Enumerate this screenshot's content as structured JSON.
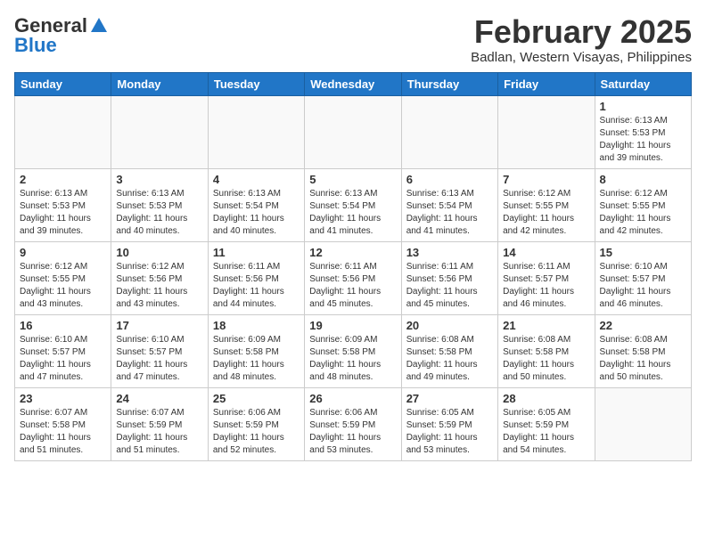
{
  "header": {
    "logo_general": "General",
    "logo_blue": "Blue",
    "month_title": "February 2025",
    "location": "Badlan, Western Visayas, Philippines"
  },
  "weekdays": [
    "Sunday",
    "Monday",
    "Tuesday",
    "Wednesday",
    "Thursday",
    "Friday",
    "Saturday"
  ],
  "weeks": [
    [
      {
        "day": "",
        "info": ""
      },
      {
        "day": "",
        "info": ""
      },
      {
        "day": "",
        "info": ""
      },
      {
        "day": "",
        "info": ""
      },
      {
        "day": "",
        "info": ""
      },
      {
        "day": "",
        "info": ""
      },
      {
        "day": "1",
        "info": "Sunrise: 6:13 AM\nSunset: 5:53 PM\nDaylight: 11 hours and 39 minutes."
      }
    ],
    [
      {
        "day": "2",
        "info": "Sunrise: 6:13 AM\nSunset: 5:53 PM\nDaylight: 11 hours and 39 minutes."
      },
      {
        "day": "3",
        "info": "Sunrise: 6:13 AM\nSunset: 5:53 PM\nDaylight: 11 hours and 40 minutes."
      },
      {
        "day": "4",
        "info": "Sunrise: 6:13 AM\nSunset: 5:54 PM\nDaylight: 11 hours and 40 minutes."
      },
      {
        "day": "5",
        "info": "Sunrise: 6:13 AM\nSunset: 5:54 PM\nDaylight: 11 hours and 41 minutes."
      },
      {
        "day": "6",
        "info": "Sunrise: 6:13 AM\nSunset: 5:54 PM\nDaylight: 11 hours and 41 minutes."
      },
      {
        "day": "7",
        "info": "Sunrise: 6:12 AM\nSunset: 5:55 PM\nDaylight: 11 hours and 42 minutes."
      },
      {
        "day": "8",
        "info": "Sunrise: 6:12 AM\nSunset: 5:55 PM\nDaylight: 11 hours and 42 minutes."
      }
    ],
    [
      {
        "day": "9",
        "info": "Sunrise: 6:12 AM\nSunset: 5:55 PM\nDaylight: 11 hours and 43 minutes."
      },
      {
        "day": "10",
        "info": "Sunrise: 6:12 AM\nSunset: 5:56 PM\nDaylight: 11 hours and 43 minutes."
      },
      {
        "day": "11",
        "info": "Sunrise: 6:11 AM\nSunset: 5:56 PM\nDaylight: 11 hours and 44 minutes."
      },
      {
        "day": "12",
        "info": "Sunrise: 6:11 AM\nSunset: 5:56 PM\nDaylight: 11 hours and 45 minutes."
      },
      {
        "day": "13",
        "info": "Sunrise: 6:11 AM\nSunset: 5:56 PM\nDaylight: 11 hours and 45 minutes."
      },
      {
        "day": "14",
        "info": "Sunrise: 6:11 AM\nSunset: 5:57 PM\nDaylight: 11 hours and 46 minutes."
      },
      {
        "day": "15",
        "info": "Sunrise: 6:10 AM\nSunset: 5:57 PM\nDaylight: 11 hours and 46 minutes."
      }
    ],
    [
      {
        "day": "16",
        "info": "Sunrise: 6:10 AM\nSunset: 5:57 PM\nDaylight: 11 hours and 47 minutes."
      },
      {
        "day": "17",
        "info": "Sunrise: 6:10 AM\nSunset: 5:57 PM\nDaylight: 11 hours and 47 minutes."
      },
      {
        "day": "18",
        "info": "Sunrise: 6:09 AM\nSunset: 5:58 PM\nDaylight: 11 hours and 48 minutes."
      },
      {
        "day": "19",
        "info": "Sunrise: 6:09 AM\nSunset: 5:58 PM\nDaylight: 11 hours and 48 minutes."
      },
      {
        "day": "20",
        "info": "Sunrise: 6:08 AM\nSunset: 5:58 PM\nDaylight: 11 hours and 49 minutes."
      },
      {
        "day": "21",
        "info": "Sunrise: 6:08 AM\nSunset: 5:58 PM\nDaylight: 11 hours and 50 minutes."
      },
      {
        "day": "22",
        "info": "Sunrise: 6:08 AM\nSunset: 5:58 PM\nDaylight: 11 hours and 50 minutes."
      }
    ],
    [
      {
        "day": "23",
        "info": "Sunrise: 6:07 AM\nSunset: 5:58 PM\nDaylight: 11 hours and 51 minutes."
      },
      {
        "day": "24",
        "info": "Sunrise: 6:07 AM\nSunset: 5:59 PM\nDaylight: 11 hours and 51 minutes."
      },
      {
        "day": "25",
        "info": "Sunrise: 6:06 AM\nSunset: 5:59 PM\nDaylight: 11 hours and 52 minutes."
      },
      {
        "day": "26",
        "info": "Sunrise: 6:06 AM\nSunset: 5:59 PM\nDaylight: 11 hours and 53 minutes."
      },
      {
        "day": "27",
        "info": "Sunrise: 6:05 AM\nSunset: 5:59 PM\nDaylight: 11 hours and 53 minutes."
      },
      {
        "day": "28",
        "info": "Sunrise: 6:05 AM\nSunset: 5:59 PM\nDaylight: 11 hours and 54 minutes."
      },
      {
        "day": "",
        "info": ""
      }
    ]
  ]
}
